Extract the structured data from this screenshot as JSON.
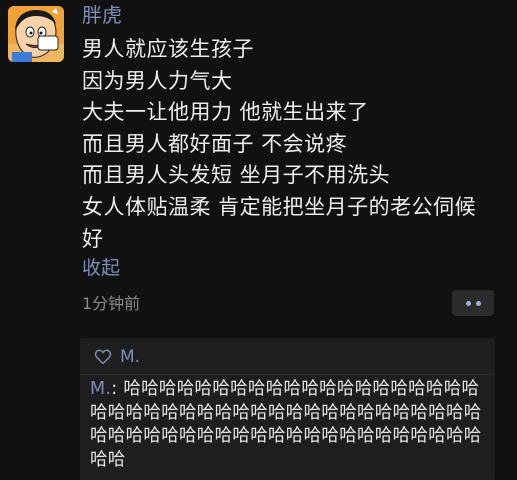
{
  "post": {
    "author": "胖虎",
    "lines": [
      "男人就应该生孩子",
      "因为男人力气大",
      "大夫一让他用力 他就生出来了",
      "而且男人都好面子 不会说疼",
      "而且男人头发短 坐月子不用洗头",
      "女人体贴温柔 肯定能把坐月子的老公伺候",
      "好"
    ],
    "collapse_label": "收起",
    "timestamp": "1分钟前"
  },
  "comments": {
    "like_icon": "heart-outline-icon",
    "liked_by": "M.",
    "items": [
      {
        "author": "M.",
        "separator": ": ",
        "text": "哈哈哈哈哈哈哈哈哈哈哈哈哈哈哈哈哈哈哈哈哈哈哈哈哈哈哈哈哈哈哈哈哈哈哈哈哈哈哈哈哈哈哈哈哈哈哈哈哈哈哈哈哈哈哈哈哈哈哈哈哈哈哈哈哈哈"
      }
    ]
  },
  "colors": {
    "background": "#111111",
    "link": "#7d8eb8",
    "text": "#ededed",
    "muted": "#8a8a8a",
    "panel": "#1e1e1e"
  }
}
